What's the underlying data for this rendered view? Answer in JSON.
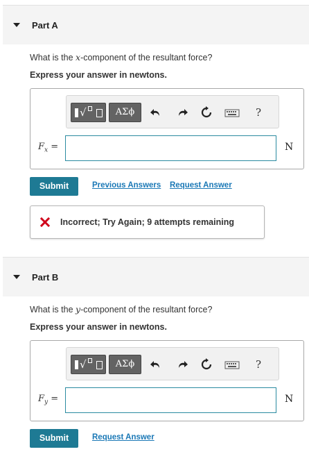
{
  "colors": {
    "accent": "#1e7a94",
    "link": "#1a78b6",
    "error": "#d0021b",
    "header_bg": "#f4f4f4"
  },
  "part_a": {
    "title": "Part A",
    "question_prefix": "What is the ",
    "question_var": "x",
    "question_suffix": "-component of the resultant force?",
    "instruction": "Express your answer in newtons.",
    "toolbar": {
      "greek_label": "ΑΣϕ",
      "help_label": "?",
      "icons": [
        "template-icon",
        "undo-icon",
        "redo-icon",
        "reset-icon",
        "keyboard-icon",
        "help-icon"
      ]
    },
    "input_var": "F",
    "input_sub": "x",
    "input_eq": " =",
    "input_value": "",
    "unit": "N",
    "submit_label": "Submit",
    "previous_answers_label": "Previous Answers",
    "request_answer_label": "Request Answer",
    "feedback": {
      "status": "incorrect",
      "message": "Incorrect; Try Again; 9 attempts remaining"
    }
  },
  "part_b": {
    "title": "Part B",
    "question_prefix": "What is the ",
    "question_var": "y",
    "question_suffix": "-component of the resultant force?",
    "instruction": "Express your answer in newtons.",
    "toolbar": {
      "greek_label": "ΑΣϕ",
      "help_label": "?"
    },
    "input_var": "F",
    "input_sub": "y",
    "input_eq": " =",
    "input_value": "",
    "unit": "N",
    "submit_label": "Submit",
    "request_answer_label": "Request Answer"
  }
}
